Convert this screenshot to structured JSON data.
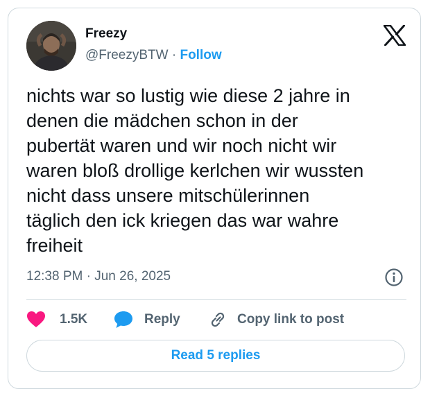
{
  "author": {
    "display_name": "Freezy",
    "handle": "@FreezyBTW",
    "separator": " · ",
    "follow_label": "Follow"
  },
  "tweet": {
    "text": "nichts war so lustig wie diese 2 jahre in\ndenen die mädchen schon in der\npubertät waren und wir noch nicht wir\nwaren bloß drollige kerlchen wir wussten\nnicht dass unsere mitschülerinnen\ntäglich den ick kriegen das war wahre\nfreiheit",
    "timestamp": "12:38 PM · Jun 26, 2025"
  },
  "actions": {
    "like_count": "1.5K",
    "reply_label": "Reply",
    "copy_link_label": "Copy link to post"
  },
  "read_replies_label": "Read 5 replies",
  "icons": {
    "brand": "x-logo-icon",
    "info": "info-icon",
    "like": "heart-icon",
    "reply": "speech-bubble-icon",
    "copy": "link-icon"
  },
  "colors": {
    "accent": "#1d9bf0",
    "like": "#f91880",
    "text": "#0f1419",
    "secondary": "#536471",
    "border": "#cfd9de"
  }
}
